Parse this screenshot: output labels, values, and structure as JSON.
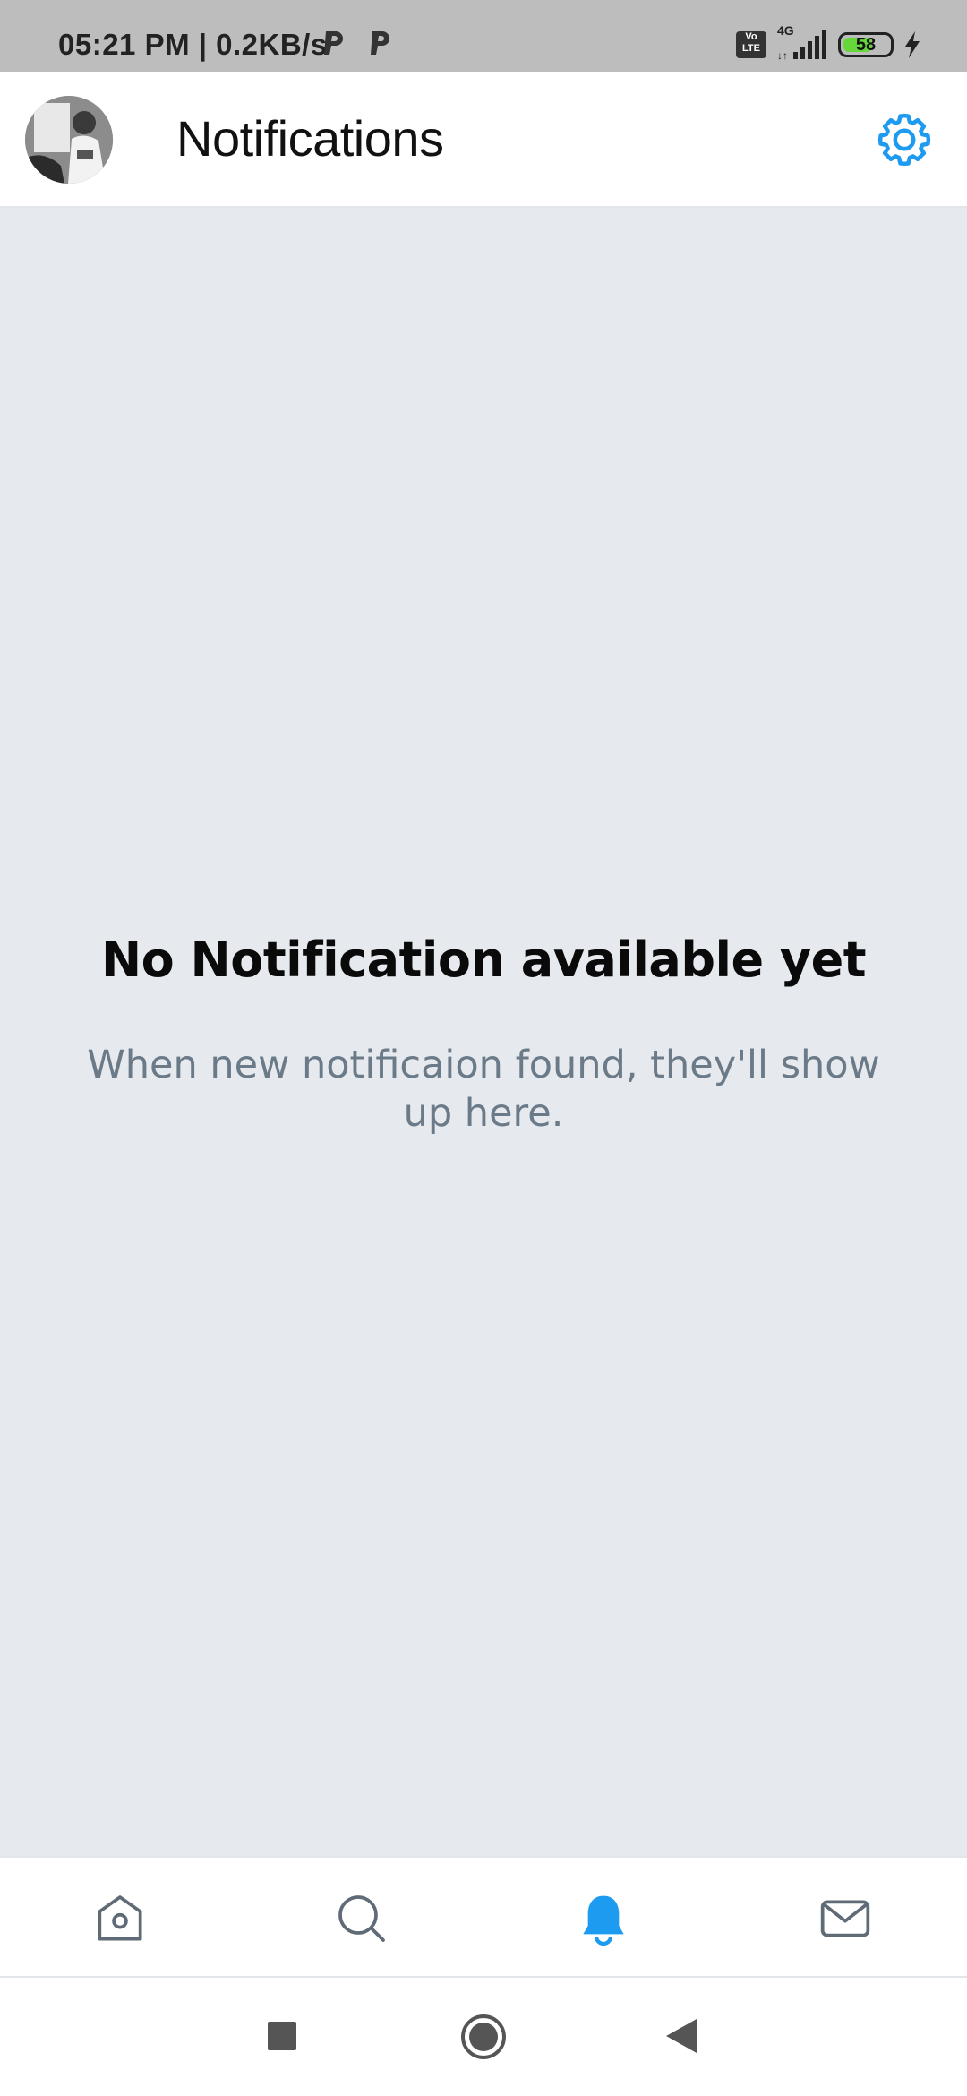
{
  "status_bar": {
    "time_speed": "05:21 PM | 0.2KB/s",
    "volte_label": "Vo\nLTE",
    "network": "4G",
    "battery": "58",
    "battery_color": "#66d63a"
  },
  "header": {
    "title": "Notifications",
    "accent_color": "#1d9bf0",
    "avatar_icon": "profile-avatar",
    "settings_icon": "gear-icon"
  },
  "empty_state": {
    "title": "No Notification available yet",
    "subtitle": "When new notificaion found, they'll show up here."
  },
  "bottom_nav": {
    "items": [
      {
        "name": "home",
        "icon": "home-icon",
        "active": false
      },
      {
        "name": "search",
        "icon": "search-icon",
        "active": false
      },
      {
        "name": "notifications",
        "icon": "bell-icon",
        "active": true
      },
      {
        "name": "messages",
        "icon": "mail-icon",
        "active": false
      }
    ]
  },
  "system_nav": {
    "icons": [
      "recents-square-icon",
      "home-circle-icon",
      "back-triangle-icon"
    ]
  }
}
